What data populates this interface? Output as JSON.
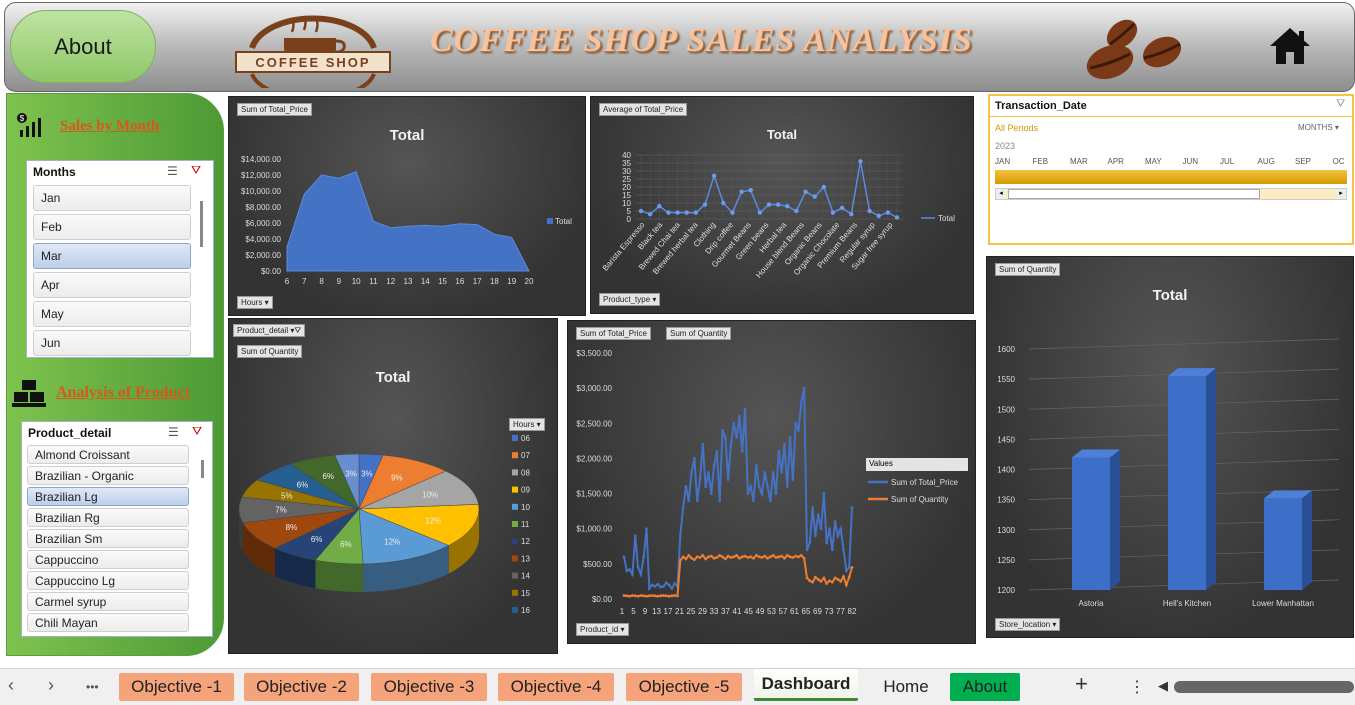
{
  "header": {
    "about_label": "About",
    "title": "COFFEE SHOP SALES ANALYSIS",
    "logo_text": "COFFEE SHOP"
  },
  "sidebar": {
    "sales_heading": "Sales by Month",
    "product_heading": "Analysis of Product",
    "months_slicer": {
      "title": "Months",
      "items": [
        "Jan",
        "Feb",
        "Mar",
        "Apr",
        "May",
        "Jun"
      ],
      "selected": "Mar"
    },
    "product_slicer": {
      "title": "Product_detail",
      "items": [
        "Almond Croissant",
        "Brazilian - Organic",
        "Brazilian Lg",
        "Brazilian Rg",
        "Brazilian Sm",
        "Cappuccino",
        "Cappuccino Lg",
        "Carmel syrup",
        "Chili Mayan"
      ],
      "selected": "Brazilian Lg"
    }
  },
  "timeline": {
    "title": "Transaction_Date",
    "periods": "All Periods",
    "level": "MONTHS",
    "year": "2023",
    "months": [
      "JAN",
      "FEB",
      "MAR",
      "APR",
      "MAY",
      "JUN",
      "JUL",
      "AUG",
      "SEP",
      "OC"
    ]
  },
  "chart_data": [
    {
      "type": "area",
      "field_button": "Sum of Total_Price",
      "axis_button": "Hours",
      "title": "Total",
      "legend": [
        "Total"
      ],
      "x": [
        6,
        7,
        8,
        9,
        10,
        11,
        12,
        13,
        14,
        15,
        16,
        17,
        18,
        19,
        20
      ],
      "values": [
        3000,
        9600,
        12000,
        11600,
        12400,
        6200,
        5400,
        5600,
        5700,
        5600,
        5900,
        5800,
        4600,
        4200,
        0
      ],
      "y_ticks": [
        "$0.00",
        "$2,000.00",
        "$4,000.00",
        "$6,000.00",
        "$8,000.00",
        "$10,000.00",
        "$12,000.00",
        "$14,000.00"
      ],
      "ylim": [
        0,
        14000
      ]
    },
    {
      "type": "line",
      "field_button": "Average of Total_Price",
      "axis_button": "Product_type",
      "title": "Total",
      "legend": [
        "Total"
      ],
      "categories": [
        "Barista Espresso",
        "Black tea",
        "Brewed Chai tea",
        "Brewed herbal tea",
        "Clothing",
        "Drip coffee",
        "Gourmet Beans",
        "Green beans",
        "Herbal tea",
        "House blend Beans",
        "Organic Beans",
        "Organic Chocolate",
        "Premium Beans",
        "Regular syrup",
        "Sugar free syrup"
      ],
      "values": [
        5,
        3,
        8,
        4,
        4,
        4,
        4,
        9,
        27,
        10,
        4,
        17,
        18,
        4,
        9,
        9,
        8,
        5,
        17,
        14,
        20,
        4,
        7,
        3,
        36,
        5,
        2,
        4,
        1
      ],
      "y_ticks": [
        "0",
        "5",
        "10",
        "15",
        "20",
        "25",
        "30",
        "35",
        "40"
      ],
      "ylim": [
        0,
        40
      ]
    },
    {
      "type": "pie",
      "field_button": "Sum of Quantity",
      "filter_button": "Product_detail",
      "legend_button": "Hours",
      "title": "Total",
      "labels": [
        "06",
        "07",
        "08",
        "09",
        "10",
        "11",
        "12",
        "13",
        "14",
        "15",
        "16"
      ],
      "values": [
        3,
        9,
        10,
        12,
        12,
        6,
        6,
        8,
        7,
        5,
        6,
        6,
        3
      ],
      "pct_labels": [
        "3%",
        "9%",
        "10%",
        "12%",
        "12%",
        "6%",
        "6%",
        "8%",
        "7%",
        "5%",
        "6%",
        "6%",
        "3%"
      ],
      "colors": [
        "#4472c4",
        "#ed7d31",
        "#a5a5a5",
        "#ffc000",
        "#5b9bd5",
        "#70ad47",
        "#264478",
        "#9e480e",
        "#636363",
        "#997300",
        "#255e91",
        "#43682b",
        "#698ed0"
      ]
    },
    {
      "type": "line",
      "field_buttons": [
        "Sum of Total_Price",
        "Sum of Quantity"
      ],
      "axis_button": "Product_id",
      "legend_title": "Values",
      "series": [
        {
          "name": "Sum of Total_Price",
          "color": "#4472c4"
        },
        {
          "name": "Sum of Quantity",
          "color": "#ed7d31"
        }
      ],
      "x_ticks": [
        "1",
        "5",
        "9",
        "13",
        "17",
        "21",
        "25",
        "29",
        "33",
        "37",
        "41",
        "45",
        "49",
        "53",
        "57",
        "61",
        "65",
        "69",
        "73",
        "77",
        "82"
      ],
      "y_ticks": [
        "$0.00",
        "$500.00",
        "$1,000.00",
        "$1,500.00",
        "$2,000.00",
        "$2,500.00",
        "$3,000.00",
        "$3,500.00"
      ],
      "ylim": [
        0,
        3500
      ],
      "total_price": [
        600,
        400,
        420,
        350,
        900,
        450,
        350,
        600,
        1000,
        150,
        200,
        180,
        210,
        170,
        180,
        230,
        200,
        150,
        220,
        180,
        900,
        1300,
        1600,
        1400,
        1800,
        2000,
        1400,
        1700,
        2200,
        1600,
        1800,
        1500,
        1900,
        2100,
        1400,
        2400,
        2300,
        1700,
        2200,
        2500,
        2300,
        2600,
        2100,
        2700,
        1500,
        1600,
        1400,
        1900,
        1600,
        1500,
        1800,
        1600,
        1400,
        1800,
        1500,
        2100,
        1800,
        2200,
        1600,
        2300,
        1700,
        2500,
        2400,
        2800,
        3000,
        700,
        800,
        1300,
        900,
        1200,
        1000,
        1500,
        800,
        1000,
        700,
        1100,
        900,
        1000,
        700,
        400,
        450,
        1300
      ],
      "quantity": [
        50,
        45,
        40,
        50,
        45,
        40,
        50,
        45,
        40,
        45,
        50,
        45,
        40,
        45,
        50,
        45,
        40,
        45,
        50,
        45,
        550,
        600,
        570,
        620,
        580,
        560,
        600,
        590,
        620,
        570,
        600,
        610,
        580,
        590,
        620,
        600,
        570,
        610,
        590,
        600,
        620,
        580,
        600,
        610,
        590,
        600,
        580,
        620,
        600,
        590,
        610,
        580,
        600,
        620,
        590,
        600,
        610,
        580,
        620,
        600,
        590,
        610,
        600,
        620,
        580,
        300,
        260,
        240,
        310,
        280,
        250,
        300,
        220,
        260,
        240,
        300,
        280,
        250,
        320,
        200,
        310,
        450
      ]
    },
    {
      "type": "bar",
      "field_button": "Sum of Quantity",
      "axis_button": "Store_location",
      "title": "Total",
      "categories": [
        "Astoria",
        "Hell's Kitchen",
        "Lower Manhattan"
      ],
      "values": [
        1420,
        1555,
        1352
      ],
      "y_ticks": [
        "1200",
        "1250",
        "1300",
        "1350",
        "1400",
        "1450",
        "1500",
        "1550",
        "1600"
      ],
      "ylim": [
        1200,
        1600
      ]
    }
  ],
  "tabbar": {
    "tabs": [
      "Objective -1",
      "Objective -2",
      "Objective -3",
      "Objective -4",
      "Objective -5",
      "Dashboard",
      "Home",
      "About"
    ],
    "more": "•••",
    "add": "+",
    "options": "⋮"
  },
  "colors": {
    "tab_objective": "#f4a37a",
    "tab_about": "#00b050",
    "sidebar": "#6db33f",
    "title": "#f4c4a2"
  }
}
